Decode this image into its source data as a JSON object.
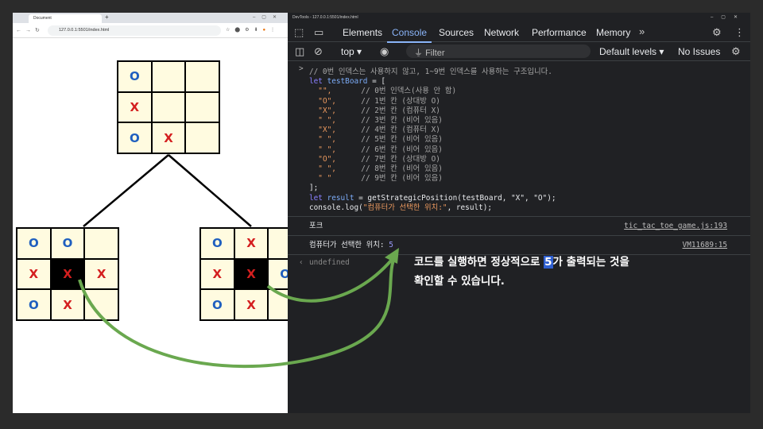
{
  "browser": {
    "tab_title": "Document",
    "url": "127.0.0.1:5501/index.html"
  },
  "boards": {
    "top": [
      "O",
      "",
      "",
      "X",
      "",
      "",
      "O",
      "X",
      ""
    ],
    "left": [
      "O",
      "O",
      "",
      "X",
      "X",
      "X",
      "O",
      "X",
      ""
    ],
    "right": [
      "O",
      "X",
      "",
      "X",
      "X",
      "O",
      "O",
      "X",
      ""
    ]
  },
  "devtools": {
    "window_title": "DevTools - 127.0.0.1:5501/index.html",
    "tabs": [
      "Elements",
      "Console",
      "Sources",
      "Network",
      "Performance",
      "Memory"
    ],
    "active_tab": "Console",
    "context": "top",
    "filter_placeholder": "Filter",
    "levels": "Default levels",
    "issues": "No Issues"
  },
  "console": {
    "comment": "// 0번 인덱스는 사용하지 않고, 1~9번 인덱스를 사용하는 구조입니다.",
    "decl": "testBoard",
    "entries": [
      {
        "v": "\"\",",
        "c": "// 0번 인덱스(사용 안 함)"
      },
      {
        "v": "\"O\",",
        "c": "// 1번 칸 (상대방 O)"
      },
      {
        "v": "\"X\",",
        "c": "// 2번 칸 (컴퓨터 X)"
      },
      {
        "v": "\" \",",
        "c": "// 3번 칸 (비어 있음)"
      },
      {
        "v": "\"X\",",
        "c": "// 4번 칸 (컴퓨터 X)"
      },
      {
        "v": "\" \",",
        "c": "// 5번 칸 (비어 있음)"
      },
      {
        "v": "\" \",",
        "c": "// 6번 칸 (비어 있음)"
      },
      {
        "v": "\"O\",",
        "c": "// 7번 칸 (상대방 O)"
      },
      {
        "v": "\" \",",
        "c": "// 8번 칸 (비어 있음)"
      },
      {
        "v": "\" \"",
        "c": "// 9번 칸 (비어 있음)"
      }
    ],
    "close": "];",
    "result_line": "getStrategicPosition(testBoard, \"X\", \"O\");",
    "log_call": "console.log(",
    "log_str": "\"컴퓨터가 선택한 위치:\"",
    "log_tail": ", result);",
    "out1": "포크",
    "out1_src": "tic_tac_toe_game.js:193",
    "out2": "컴퓨터가 선택한 위치:",
    "out2_num": "5",
    "out2_src": "VM11689:15",
    "undefined": "undefined"
  },
  "annotation": {
    "line1_pre": "코드를 실행하면 정상적으로 ",
    "line1_num": "5",
    "line1_post": "가 출력되는 것을",
    "line2": "확인할 수 있습니다."
  },
  "colors": {
    "arrow": "#6aa84f",
    "o_mark": "#1f5fbf",
    "x_mark": "#d41f1f",
    "accent": "#8ab4f8"
  }
}
